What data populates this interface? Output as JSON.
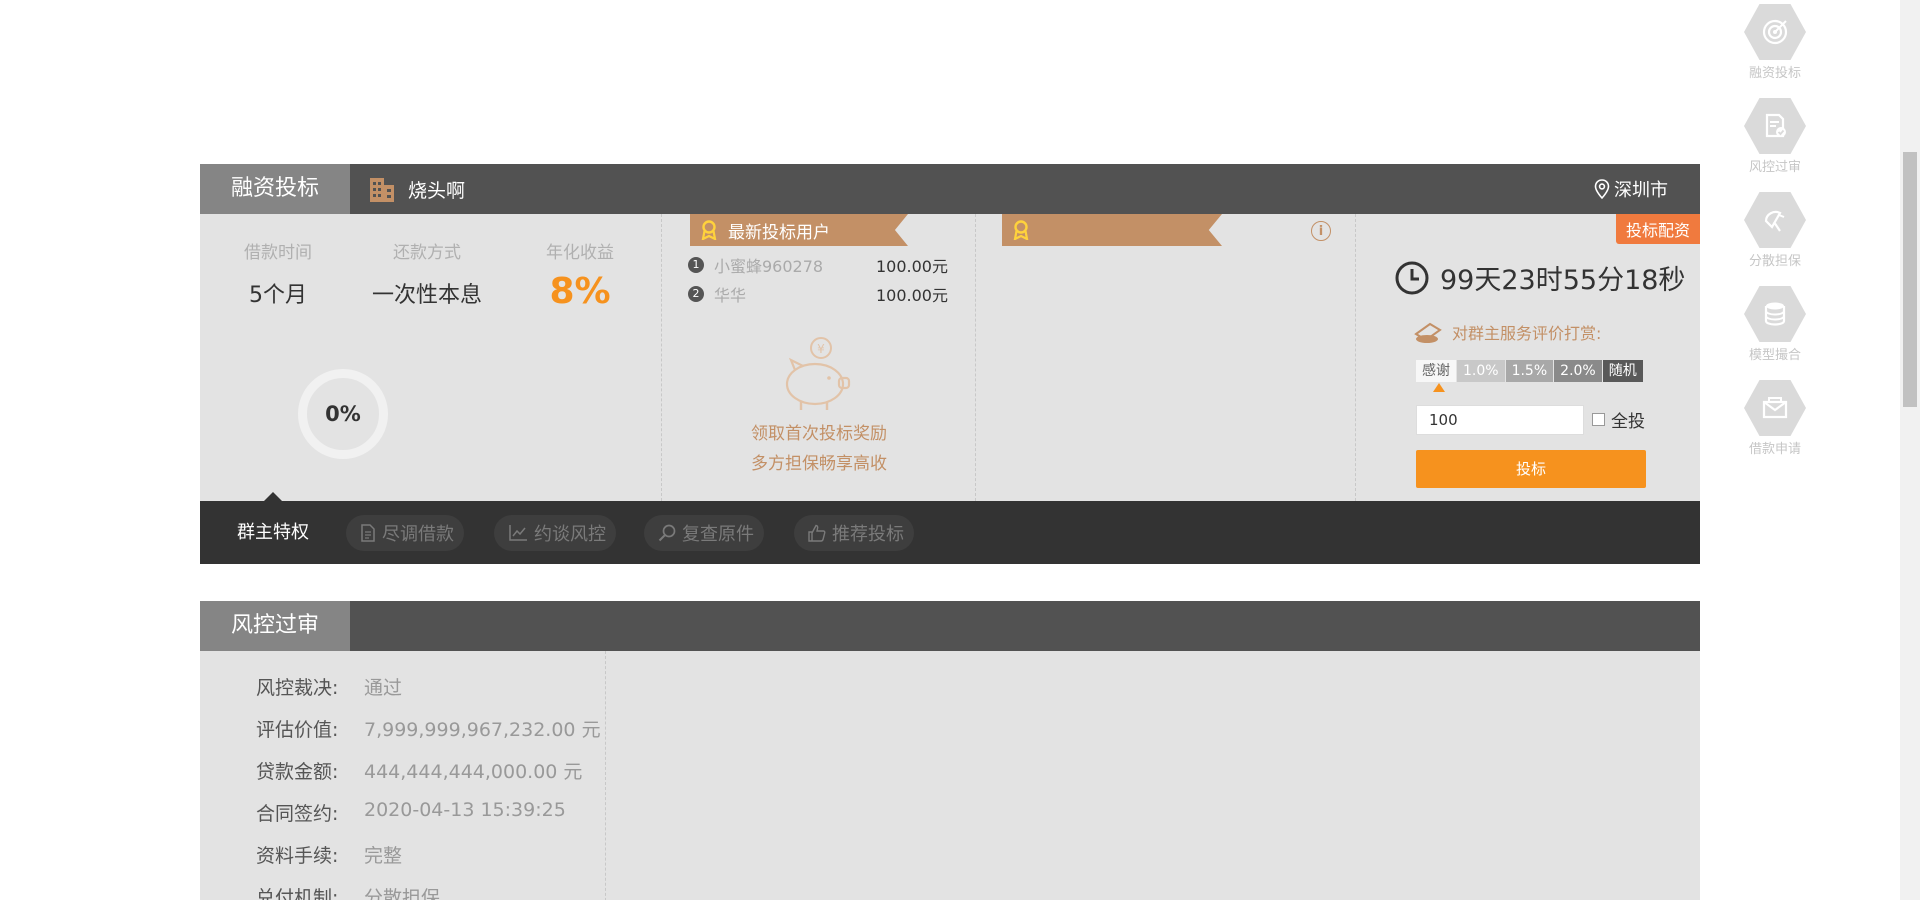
{
  "section1": {
    "title": "融资投标",
    "company": "烧头啊",
    "location": "深圳市",
    "stats": [
      {
        "label": "借款时间",
        "value": "5个月"
      },
      {
        "label": "还款方式",
        "value": "一次性本息"
      },
      {
        "label": "年化收益",
        "value": "8%"
      }
    ],
    "progress": "0%",
    "latest_title": "最新投标用户",
    "latest_users": [
      {
        "rank": "1",
        "name": "小蜜蜂960278",
        "amount": "100.00元"
      },
      {
        "rank": "2",
        "name": "华华",
        "amount": "100.00元"
      }
    ],
    "reward_line1": "领取首次投标奖励",
    "reward_line2": "多方担保畅享高收",
    "info_icon": "i",
    "badge": "投标配资",
    "countdown": "99天23时55分18秒",
    "rating_title": "对群主服务评价打赏:",
    "rating_options": [
      "感谢",
      "1.0%",
      "1.5%",
      "2.0%",
      "随机"
    ],
    "amount_value": "100",
    "all_in_label": "全投",
    "invest_button": "投标"
  },
  "tabs": {
    "active": "群主特权",
    "items": [
      {
        "label": "尽调借款",
        "icon": "document-icon"
      },
      {
        "label": "约谈风控",
        "icon": "chart-icon"
      },
      {
        "label": "复查原件",
        "icon": "search-icon"
      },
      {
        "label": "推荐投标",
        "icon": "thumbs-up-icon"
      }
    ]
  },
  "section2": {
    "title": "风控过审",
    "rows": [
      {
        "key": "风控裁决:",
        "value": "通过"
      },
      {
        "key": "评估价值:",
        "value": "7,999,999,967,232.00 元"
      },
      {
        "key": "贷款金额:",
        "value": "444,444,444,000.00 元"
      },
      {
        "key": "合同签约:",
        "value": "2020-04-13 15:39:25"
      },
      {
        "key": "资料手续:",
        "value": "完整"
      },
      {
        "key": "兑付机制:",
        "value": "分散担保"
      }
    ]
  },
  "rail": [
    {
      "label": "融资投标",
      "icon": "target-icon"
    },
    {
      "label": "风控过审",
      "icon": "audit-icon"
    },
    {
      "label": "分散担保",
      "icon": "umbrella-icon"
    },
    {
      "label": "模型撮合",
      "icon": "database-icon"
    },
    {
      "label": "借款申请",
      "icon": "envelope-icon"
    }
  ],
  "colors": {
    "accent": "#f6921e",
    "ribbon": "#c39066",
    "header": "#525252",
    "badge": "#f07a3e"
  }
}
